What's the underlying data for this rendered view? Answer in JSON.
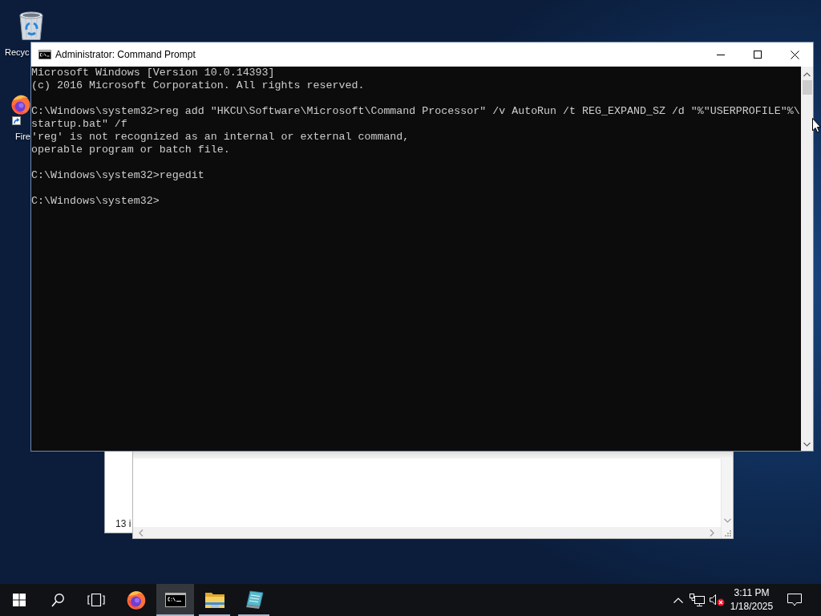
{
  "desktop": {
    "icons": [
      {
        "kind": "recycle-bin",
        "label": "Recyc"
      },
      {
        "kind": "browser-shortcut",
        "label": "Fire"
      }
    ]
  },
  "explorer_window": {
    "status_text": "13 i"
  },
  "cmd_window": {
    "title": "Administrator: Command Prompt",
    "console": {
      "paragraphs": [
        [
          "Microsoft Windows [Version 10.0.14393]",
          "(c) 2016 Microsoft Corporation. All rights reserved."
        ],
        [
          "C:\\Windows\\system32>reg add \"HKCU\\Software\\Microsoft\\Command Processor\" /v AutoRun /t REG_EXPAND_SZ /d \"%\"USERPROFILE\"%\\",
          "startup.bat\" /f",
          "'reg' is not recognized as an internal or external command,",
          "operable program or batch file."
        ],
        [
          "C:\\Windows\\system32>regedit"
        ],
        [
          "C:\\Windows\\system32>"
        ]
      ]
    }
  },
  "taskbar": {
    "apps": [
      {
        "kind": "browser",
        "running": false,
        "selected": false
      },
      {
        "kind": "terminal",
        "running": true,
        "selected": true
      },
      {
        "kind": "folder",
        "running": true,
        "selected": false
      },
      {
        "kind": "notepad",
        "running": true,
        "selected": false
      }
    ]
  },
  "tray": {
    "volume_muted": true,
    "time": "3:11 PM",
    "date": "1/18/2025"
  }
}
